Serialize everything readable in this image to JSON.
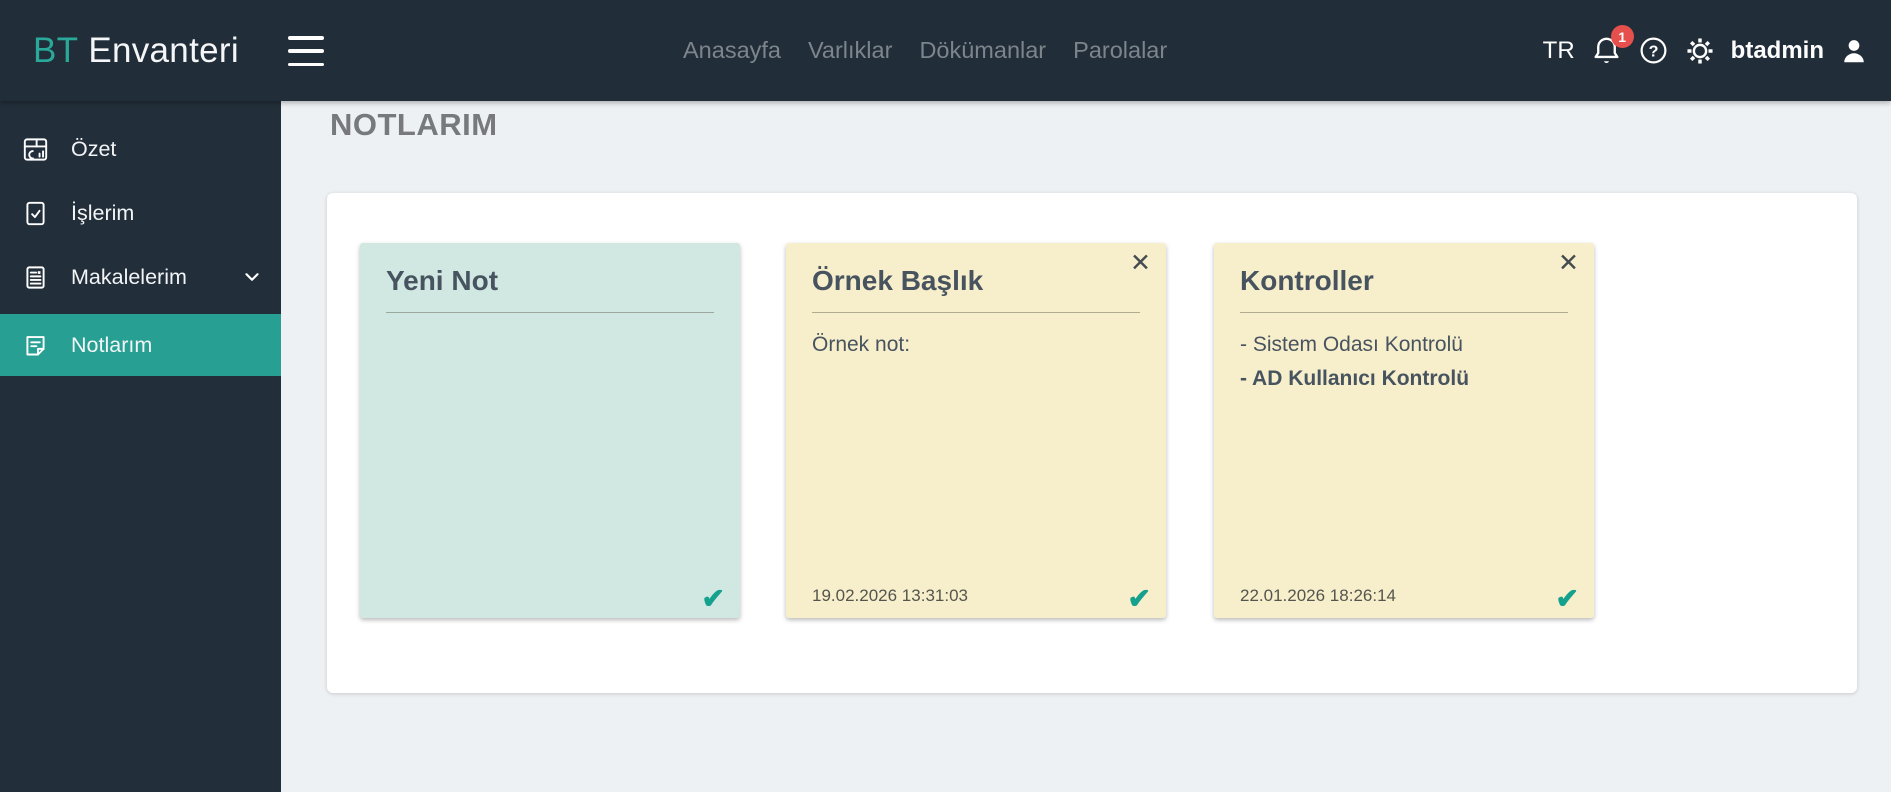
{
  "brand": {
    "prefix": "BT",
    "name": "Envanteri"
  },
  "topnav": {
    "links": [
      {
        "label": "Anasayfa"
      },
      {
        "label": "Varlıklar"
      },
      {
        "label": "Dökümanlar"
      },
      {
        "label": "Parolalar"
      }
    ],
    "language": "TR",
    "notification_count": "1",
    "username": "btadmin"
  },
  "sidebar": {
    "items": [
      {
        "label": "Özet"
      },
      {
        "label": "İşlerim"
      },
      {
        "label": "Makalelerim"
      },
      {
        "label": "Notlarım"
      }
    ]
  },
  "page": {
    "title": "NOTLARIM"
  },
  "notes": [
    {
      "title": "Yeni Not",
      "body": [],
      "timestamp": "",
      "check": "✔"
    },
    {
      "title": "Örnek Başlık",
      "body": [
        "Örnek not:"
      ],
      "timestamp": "19.02.2026 13:31:03",
      "close": "✕",
      "check": "✔"
    },
    {
      "title": "Kontroller",
      "body": [
        "- Sistem Odası Kontrolü",
        "- AD Kullanıcı Kontrolü"
      ],
      "timestamp": "22.01.2026 18:26:14",
      "close": "✕",
      "check": "✔"
    }
  ],
  "colors": {
    "accent_teal": "#27a093",
    "dark_navy": "#212d38",
    "note_mint": "#d1e8e2",
    "note_yellow": "#f7eecb",
    "badge_red": "#e5504c",
    "check_teal": "#14a18e"
  }
}
